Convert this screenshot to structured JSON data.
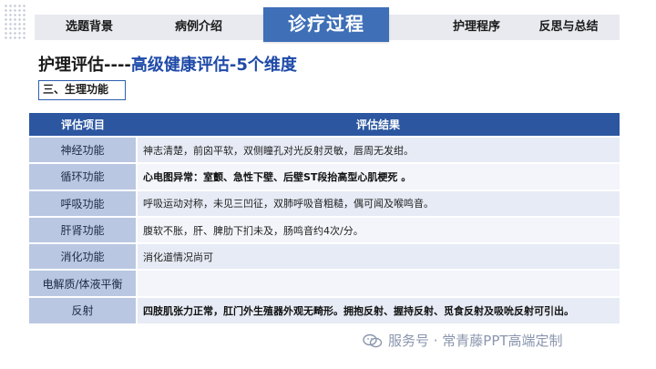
{
  "nav": {
    "items": [
      "选题背景",
      "病例介绍",
      "护理程序",
      "反思与总结"
    ],
    "active": "诊疗过程"
  },
  "title": {
    "prefix": "护理评估----",
    "highlight": "高级健康评估-5个维度"
  },
  "section": "三、生理功能",
  "table": {
    "headers": [
      "评估项目",
      "评估结果"
    ],
    "rows": [
      {
        "item": "神经功能",
        "result": "神志清楚，前囟平软，双侧瞳孔对光反射灵敏，唇周无发绀。"
      },
      {
        "item": "循环功能",
        "result": "心电图异常：室颤、急性下壁、后壁ST段抬高型心肌梗死 。"
      },
      {
        "item": "呼吸功能",
        "result": "呼吸运动对称，未见三凹征，双肺呼吸音粗糙，偶可闻及喉鸣音。"
      },
      {
        "item": "肝肾功能",
        "result": "腹软不胀，肝、脾肋下扪未及，肠鸣音约4次/分。"
      },
      {
        "item": "消化功能",
        "result": "消化道情况尚可"
      },
      {
        "item": "电解质/体液平衡",
        "result": ""
      },
      {
        "item": "反射",
        "result": "四肢肌张力正常，肛门外生殖器外观无畸形。拥抱反射、握持反射、觅食反射及吸吮反射可引出。"
      }
    ]
  },
  "watermark": "服务号 · 常青藤PPT高端定制",
  "colors": {
    "accent": "#3e6fb7",
    "header": "#2c56a0",
    "item_bg": "#b9c7e2",
    "title_blue": "#1f4aa8"
  }
}
